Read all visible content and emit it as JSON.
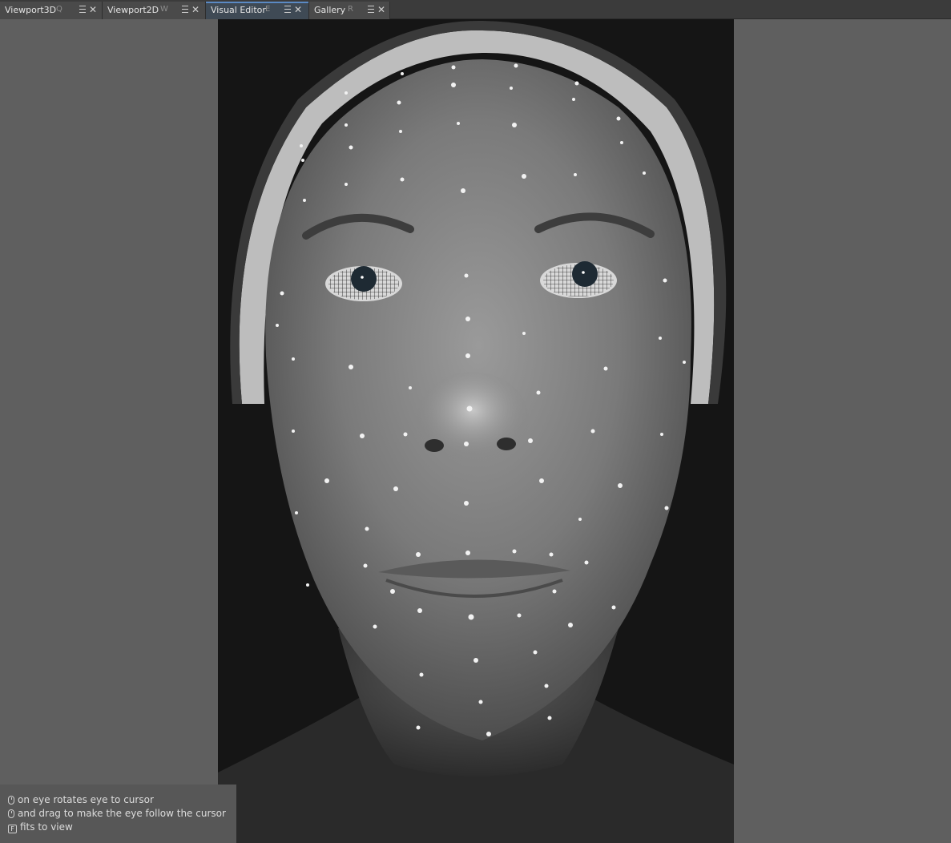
{
  "tabs": [
    {
      "label": "Viewport3D",
      "shortcut": "Q",
      "active": false
    },
    {
      "label": "Viewport2D",
      "shortcut": "W",
      "active": false
    },
    {
      "label": "Visual Editor",
      "shortcut": "E",
      "active": true
    },
    {
      "label": "Gallery",
      "shortcut": "R",
      "active": false
    }
  ],
  "icons": {
    "tab_menu": "hamburger-menu-icon",
    "tab_close": "close-icon",
    "mouse": "mouse-click-icon",
    "key": "keyboard-key-icon"
  },
  "help": {
    "line1": "on eye rotates eye to cursor",
    "line2": "and drag to make the eye follow the cursor",
    "line3_key": "F",
    "line3": "fits to view"
  },
  "colors": {
    "background": "#5f5f5f",
    "tabbar": "#3b3b3b",
    "active_tab_accent": "#5a8ac4"
  }
}
